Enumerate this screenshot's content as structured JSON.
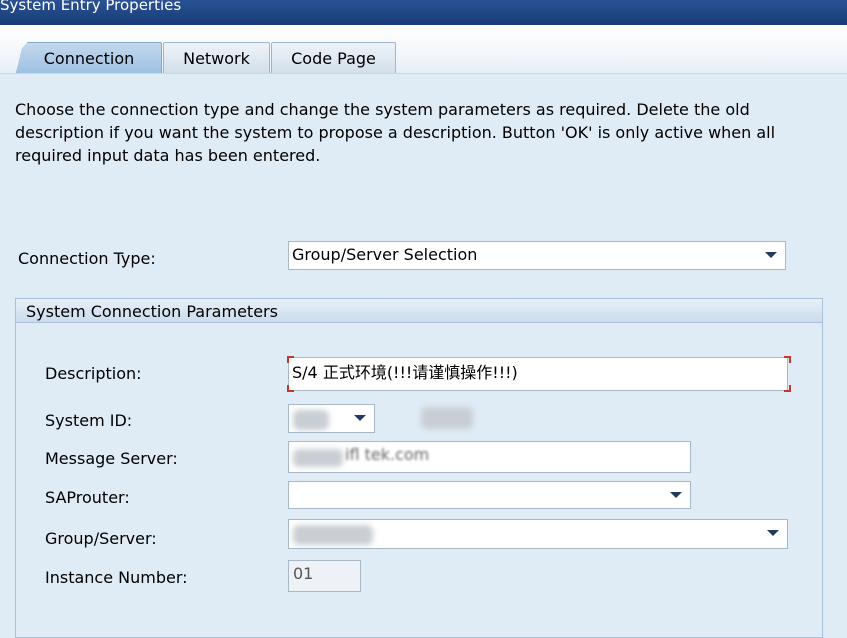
{
  "window": {
    "title": "System Entry Properties"
  },
  "tabs": [
    {
      "label": "Connection",
      "active": true
    },
    {
      "label": "Network",
      "active": false
    },
    {
      "label": "Code Page",
      "active": false
    }
  ],
  "intro_text": "Choose the connection type and change the system parameters as required. Delete the old description if you want the system to propose a description. Button 'OK' is only active when all required input data has been entered.",
  "connection_type": {
    "label": "Connection Type:",
    "value": "Group/Server Selection"
  },
  "group": {
    "title": "System Connection Parameters",
    "description": {
      "label": "Description:",
      "value": "S/4 正式环境(!!!请谨慎操作!!!)"
    },
    "system_id": {
      "label": "System ID:"
    },
    "message_server": {
      "label": "Message Server:",
      "value_visible_part": "ifl tek.com"
    },
    "saprouter": {
      "label": "SAProuter:",
      "value": ""
    },
    "group_server": {
      "label": "Group/Server:"
    },
    "instance_number": {
      "label": "Instance Number:",
      "value": "01"
    }
  },
  "colors": {
    "titlebar": "#1f4785",
    "tab_active": "#a9c8e8",
    "panel_bg": "#dfebf5",
    "focus_marker": "#c0392b"
  }
}
